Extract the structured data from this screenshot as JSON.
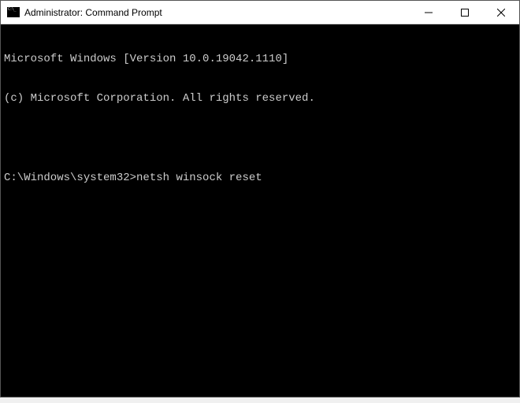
{
  "window": {
    "title": "Administrator: Command Prompt"
  },
  "terminal": {
    "line1": "Microsoft Windows [Version 10.0.19042.1110]",
    "line2": "(c) Microsoft Corporation. All rights reserved.",
    "prompt": "C:\\Windows\\system32>",
    "command": "netsh winsock reset"
  }
}
